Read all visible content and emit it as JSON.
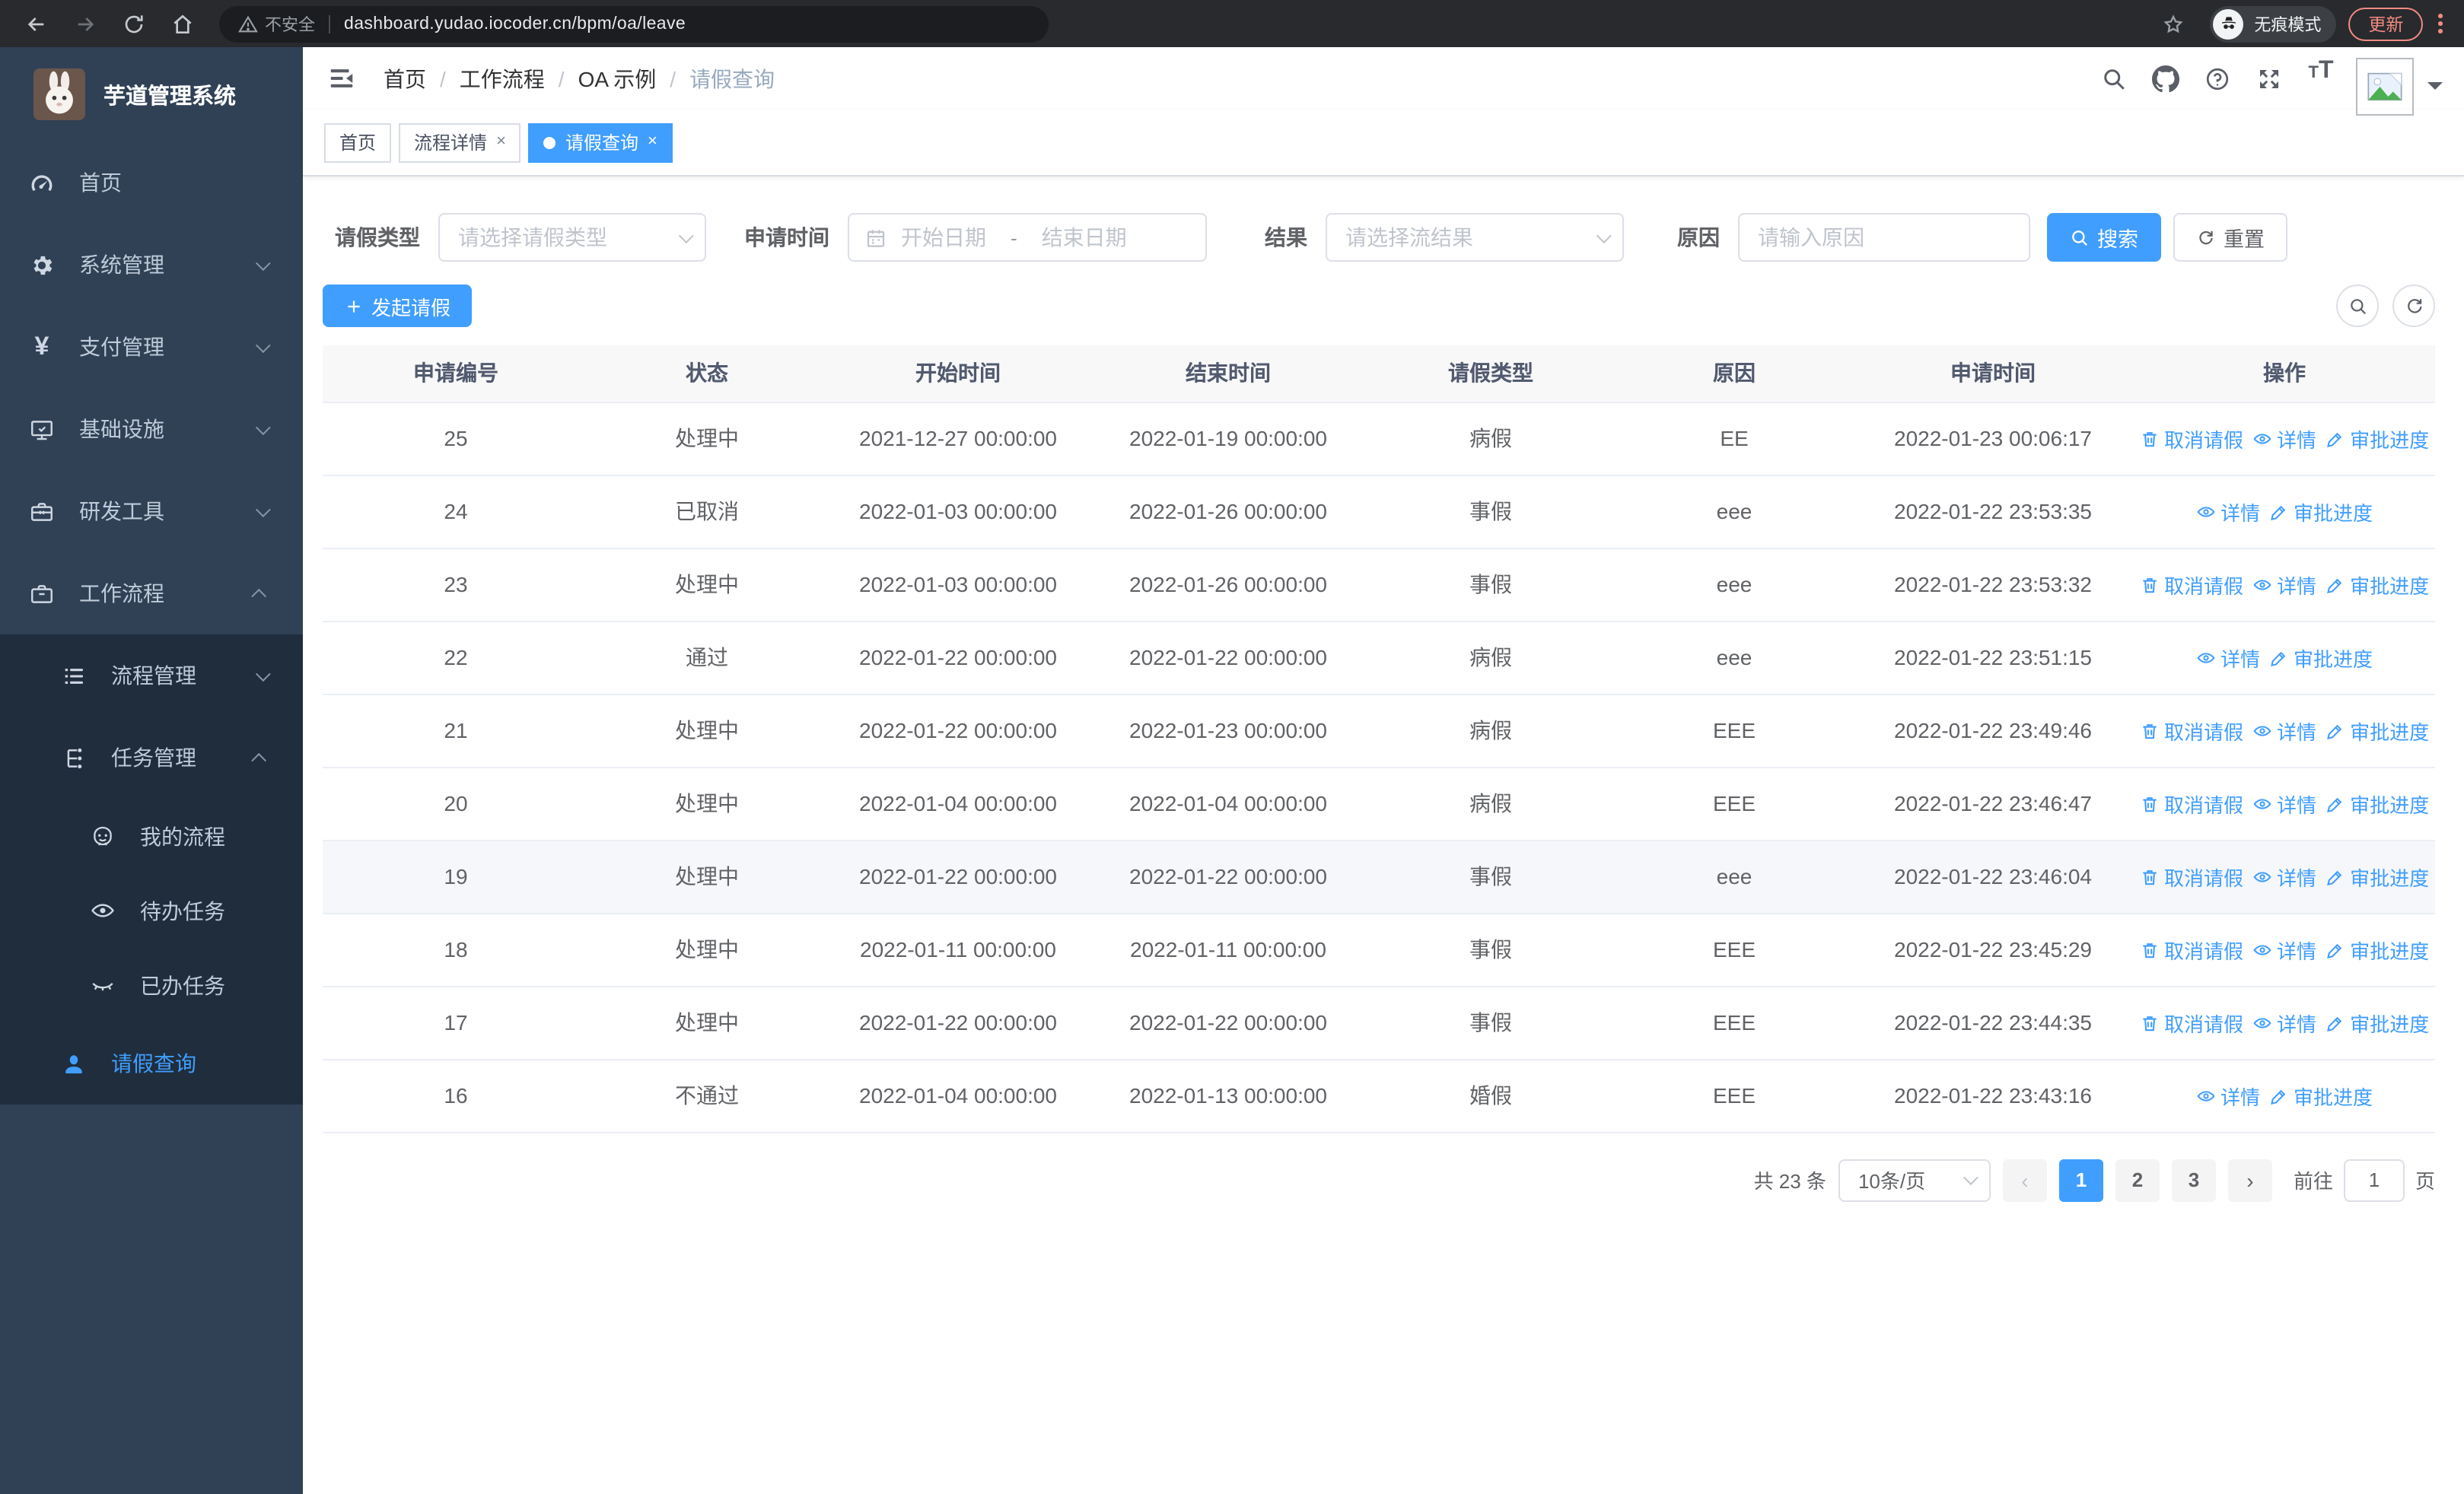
{
  "browser": {
    "security_label": "不安全",
    "url": "dashboard.yudao.iocoder.cn/bpm/oa/leave",
    "incognito_label": "无痕模式",
    "update_label": "更新"
  },
  "sidebar": {
    "title": "芋道管理系统",
    "items": [
      {
        "id": "home",
        "label": "首页",
        "icon": "gauge-icon",
        "level": 1,
        "submenu": false
      },
      {
        "id": "system",
        "label": "系统管理",
        "icon": "gear-icon",
        "level": 1,
        "chevron": "down",
        "submenu": false
      },
      {
        "id": "payment",
        "label": "支付管理",
        "icon": "yen-icon",
        "level": 1,
        "chevron": "down",
        "submenu": false
      },
      {
        "id": "infra",
        "label": "基础设施",
        "icon": "monitor-icon",
        "level": 1,
        "chevron": "down",
        "submenu": false
      },
      {
        "id": "devtools",
        "label": "研发工具",
        "icon": "toolbox-icon",
        "level": 1,
        "chevron": "down",
        "submenu": false
      },
      {
        "id": "workflow",
        "label": "工作流程",
        "icon": "briefcase-icon",
        "level": 1,
        "chevron": "up",
        "submenu": false
      },
      {
        "id": "process-mgmt",
        "label": "流程管理",
        "icon": "list-icon",
        "level": 2,
        "chevron": "down",
        "submenu": true
      },
      {
        "id": "task-mgmt",
        "label": "任务管理",
        "icon": "tree-icon",
        "level": 2,
        "chevron": "up",
        "submenu": true
      },
      {
        "id": "my-process",
        "label": "我的流程",
        "icon": "robot-icon",
        "level": 3,
        "submenu": true
      },
      {
        "id": "todo-task",
        "label": "待办任务",
        "icon": "eye-open-icon",
        "level": 3,
        "submenu": true
      },
      {
        "id": "done-task",
        "label": "已办任务",
        "icon": "eye-closed-icon",
        "level": 3,
        "submenu": true
      },
      {
        "id": "leave-query",
        "label": "请假查询",
        "icon": "user-icon",
        "level": 2,
        "submenu": true,
        "active": true
      }
    ]
  },
  "header": {
    "breadcrumb": [
      "首页",
      "工作流程",
      "OA 示例",
      "请假查询"
    ]
  },
  "tabs": [
    {
      "label": "首页",
      "closable": false,
      "active": false
    },
    {
      "label": "流程详情",
      "closable": true,
      "active": false
    },
    {
      "label": "请假查询",
      "closable": true,
      "active": true
    }
  ],
  "filters": {
    "leave_type_label": "请假类型",
    "leave_type_placeholder": "请选择请假类型",
    "apply_time_label": "申请时间",
    "date_start_placeholder": "开始日期",
    "date_separator": "-",
    "date_end_placeholder": "结束日期",
    "result_label": "结果",
    "result_placeholder": "请选择流结果",
    "reason_label": "原因",
    "reason_placeholder": "请输入原因",
    "search_label": "搜索",
    "reset_label": "重置"
  },
  "toolbar": {
    "create_label": "发起请假"
  },
  "table": {
    "headers": [
      "申请编号",
      "状态",
      "开始时间",
      "结束时间",
      "请假类型",
      "原因",
      "申请时间",
      "操作"
    ],
    "action_labels": {
      "cancel": "取消请假",
      "detail": "详情",
      "progress": "审批进度"
    },
    "rows": [
      {
        "id": "25",
        "status": "处理中",
        "start": "2021-12-27 00:00:00",
        "end": "2022-01-19 00:00:00",
        "type": "病假",
        "reason": "EE",
        "apply_time": "2022-01-23 00:06:17",
        "actions": [
          "cancel",
          "detail",
          "progress"
        ],
        "highlight": false
      },
      {
        "id": "24",
        "status": "已取消",
        "start": "2022-01-03 00:00:00",
        "end": "2022-01-26 00:00:00",
        "type": "事假",
        "reason": "eee",
        "apply_time": "2022-01-22 23:53:35",
        "actions": [
          "detail",
          "progress"
        ],
        "highlight": false
      },
      {
        "id": "23",
        "status": "处理中",
        "start": "2022-01-03 00:00:00",
        "end": "2022-01-26 00:00:00",
        "type": "事假",
        "reason": "eee",
        "apply_time": "2022-01-22 23:53:32",
        "actions": [
          "cancel",
          "detail",
          "progress"
        ],
        "highlight": false
      },
      {
        "id": "22",
        "status": "通过",
        "start": "2022-01-22 00:00:00",
        "end": "2022-01-22 00:00:00",
        "type": "病假",
        "reason": "eee",
        "apply_time": "2022-01-22 23:51:15",
        "actions": [
          "detail",
          "progress"
        ],
        "highlight": false
      },
      {
        "id": "21",
        "status": "处理中",
        "start": "2022-01-22 00:00:00",
        "end": "2022-01-23 00:00:00",
        "type": "病假",
        "reason": "EEE",
        "apply_time": "2022-01-22 23:49:46",
        "actions": [
          "cancel",
          "detail",
          "progress"
        ],
        "highlight": false
      },
      {
        "id": "20",
        "status": "处理中",
        "start": "2022-01-04 00:00:00",
        "end": "2022-01-04 00:00:00",
        "type": "病假",
        "reason": "EEE",
        "apply_time": "2022-01-22 23:46:47",
        "actions": [
          "cancel",
          "detail",
          "progress"
        ],
        "highlight": false
      },
      {
        "id": "19",
        "status": "处理中",
        "start": "2022-01-22 00:00:00",
        "end": "2022-01-22 00:00:00",
        "type": "事假",
        "reason": "eee",
        "apply_time": "2022-01-22 23:46:04",
        "actions": [
          "cancel",
          "detail",
          "progress"
        ],
        "highlight": true
      },
      {
        "id": "18",
        "status": "处理中",
        "start": "2022-01-11 00:00:00",
        "end": "2022-01-11 00:00:00",
        "type": "事假",
        "reason": "EEE",
        "apply_time": "2022-01-22 23:45:29",
        "actions": [
          "cancel",
          "detail",
          "progress"
        ],
        "highlight": false
      },
      {
        "id": "17",
        "status": "处理中",
        "start": "2022-01-22 00:00:00",
        "end": "2022-01-22 00:00:00",
        "type": "事假",
        "reason": "EEE",
        "apply_time": "2022-01-22 23:44:35",
        "actions": [
          "cancel",
          "detail",
          "progress"
        ],
        "highlight": false
      },
      {
        "id": "16",
        "status": "不通过",
        "start": "2022-01-04 00:00:00",
        "end": "2022-01-13 00:00:00",
        "type": "婚假",
        "reason": "EEE",
        "apply_time": "2022-01-22 23:43:16",
        "actions": [
          "detail",
          "progress"
        ],
        "highlight": false
      }
    ]
  },
  "pagination": {
    "total_label": "共 23 条",
    "page_size_label": "10条/页",
    "pages": [
      "1",
      "2",
      "3"
    ],
    "active_page": "1",
    "goto_label": "前往",
    "goto_value": "1",
    "unit_label": "页"
  }
}
